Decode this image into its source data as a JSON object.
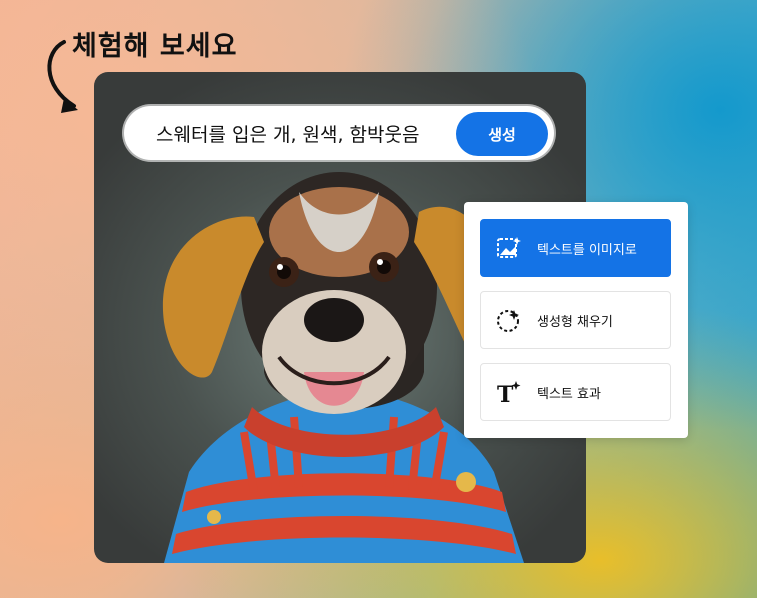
{
  "headline": "체험해 보세요",
  "prompt": {
    "text": "스웨터를 입은 개, 원색, 함박웃음",
    "generate_label": "생성"
  },
  "menu": {
    "items": [
      {
        "label": "텍스트를 이미지로",
        "icon": "image-sparkle-icon",
        "active": true
      },
      {
        "label": "생성형 채우기",
        "icon": "fill-sparkle-icon",
        "active": false
      },
      {
        "label": "텍스트 효과",
        "icon": "text-effects-icon",
        "active": false
      }
    ]
  },
  "colors": {
    "accent": "#1473e6",
    "sweater_blue": "#2f8ed6",
    "sweater_red": "#d9462f",
    "ears": "#c98a2c"
  }
}
